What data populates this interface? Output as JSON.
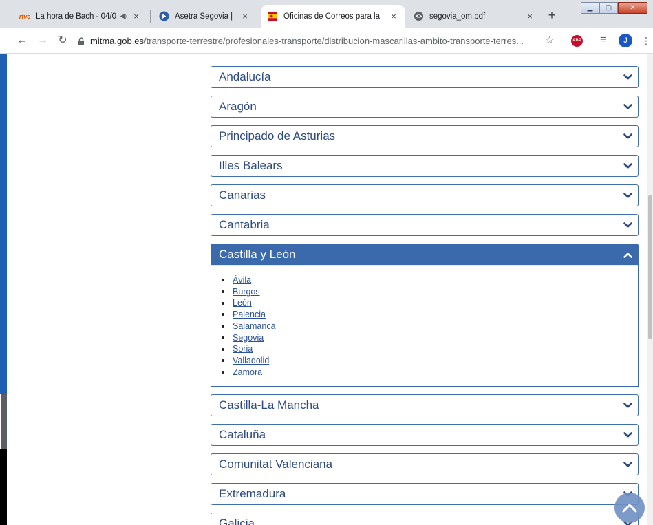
{
  "browser": {
    "tabs": [
      {
        "title": "La hora de Bach - 04/0",
        "favicon": "rtve-icon",
        "favicon_text": "rtve",
        "audio": true
      },
      {
        "title": "Asetra Segovia |",
        "favicon": "asetra-icon"
      },
      {
        "title": "Oficinas de Correos para la",
        "favicon": "gov-spain-icon",
        "active": true
      },
      {
        "title": "segovia_om.pdf",
        "favicon": "globe-icon"
      }
    ],
    "close_glyph": "×",
    "newtab_glyph": "+",
    "url_host": "mitma.gob.es",
    "url_path": "/transporte-terrestre/profesionales-transporte/distribucion-mascarillas-ambito-transporte-terres...",
    "abp_label": "ABP",
    "avatar_initial": "J"
  },
  "regions": [
    {
      "name": "Andalucía",
      "open": false
    },
    {
      "name": "Aragón",
      "open": false
    },
    {
      "name": "Principado de Asturias",
      "open": false
    },
    {
      "name": "Illes Balears",
      "open": false
    },
    {
      "name": "Canarias",
      "open": false
    },
    {
      "name": "Cantabria",
      "open": false
    },
    {
      "name": "Castilla y León",
      "open": true,
      "provinces": [
        "Ávila",
        "Burgos",
        "León",
        "Palencia",
        "Salamanca",
        "Segovia",
        "Soria",
        "Valladolid",
        "Zamora"
      ]
    },
    {
      "name": "Castilla-La Mancha",
      "open": false
    },
    {
      "name": "Cataluña",
      "open": false
    },
    {
      "name": "Comunitat Valenciana",
      "open": false
    },
    {
      "name": "Extremadura",
      "open": false
    },
    {
      "name": "Galicia",
      "open": false
    }
  ],
  "colors": {
    "accent": "#3a6aac",
    "link": "#2a5298",
    "header_text": "#2d4a82"
  }
}
